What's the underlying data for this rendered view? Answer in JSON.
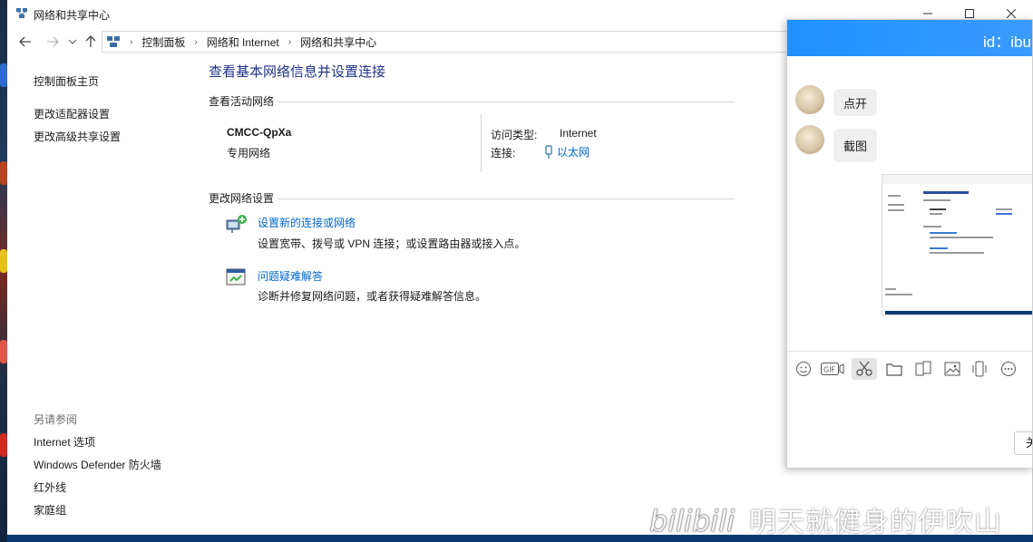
{
  "window": {
    "title": "网络和共享中心",
    "controls": [
      "minimize",
      "maximize",
      "close"
    ]
  },
  "address_bar": {
    "crumbs": [
      "控制面板",
      "网络和 Internet",
      "网络和共享中心"
    ]
  },
  "sidebar": {
    "links": [
      "控制面板主页",
      "更改适配器设置",
      "更改高级共享设置"
    ],
    "see_also_heading": "另请参阅",
    "see_also": [
      "Internet 选项",
      "Windows Defender 防火墙",
      "红外线",
      "家庭组"
    ]
  },
  "main": {
    "heading": "查看基本网络信息并设置连接",
    "active_networks_label": "查看活动网络",
    "network_name": "CMCC-QpXa",
    "network_type": "专用网络",
    "access_type_label": "访问类型:",
    "access_type_value": "Internet",
    "connection_label": "连接:",
    "connection_value": "以太网",
    "change_settings_label": "更改网络设置",
    "tasks": [
      {
        "link": "设置新的连接或网络",
        "desc": "设置宽带、拨号或 VPN 连接；或设置路由器或接入点。",
        "icon": "network-setup-icon"
      },
      {
        "link": "问题疑难解答",
        "desc": "诊断并修复网络问题，或者获得疑难解答信息。",
        "icon": "troubleshoot-icon"
      }
    ]
  },
  "chat": {
    "header_text": "id：ibu",
    "messages": [
      "点开",
      "截图"
    ],
    "tools": [
      "emoji-icon",
      "gif-icon",
      "scissors-icon",
      "folder-icon",
      "screen-share-icon",
      "image-icon",
      "phone-icon",
      "more-icon"
    ],
    "send_label": "关"
  },
  "watermark": {
    "logo": "bilibili",
    "text": "明天就健身的伊吹山"
  },
  "colors": {
    "link_blue": "#0066cc",
    "heading_blue": "#1e3287",
    "chat_header": "#1e90ff"
  }
}
